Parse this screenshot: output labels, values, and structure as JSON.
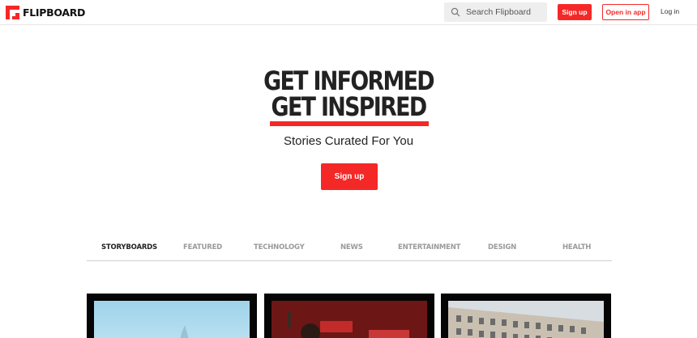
{
  "header": {
    "logo_text": "FLIPBOARD",
    "search_placeholder": "Search Flipboard",
    "signup_label": "Sign up",
    "open_in_app_label": "Open in app",
    "login_label": "Log in"
  },
  "hero": {
    "title_line1": "GET INFORMED",
    "title_line2": "GET INSPIRED",
    "subtitle": "Stories Curated For You",
    "cta_label": "Sign up"
  },
  "tabs": [
    {
      "label": "STORYBOARDS",
      "active": true
    },
    {
      "label": "FEATURED",
      "active": false
    },
    {
      "label": "TECHNOLOGY",
      "active": false
    },
    {
      "label": "NEWS",
      "active": false
    },
    {
      "label": "ENTERTAINMENT",
      "active": false
    },
    {
      "label": "DESIGN",
      "active": false
    },
    {
      "label": "HEALTH",
      "active": false
    }
  ],
  "colors": {
    "brand_red": "#f52828",
    "text_dark": "#222222",
    "tab_inactive": "#9a9a9a"
  }
}
